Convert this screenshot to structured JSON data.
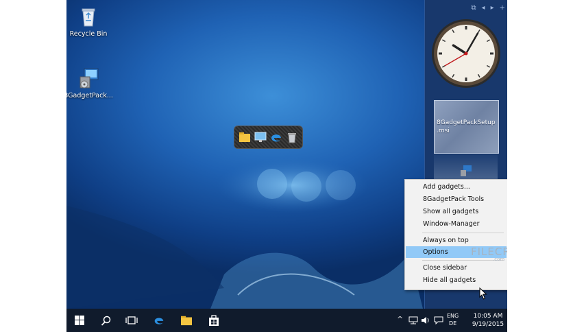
{
  "desktop": {
    "icons": [
      {
        "label": "Recycle Bin",
        "icon": "recycle-bin-icon"
      },
      {
        "label": "8GadgetPack...",
        "icon": "installer-icon"
      }
    ]
  },
  "launcher": {
    "items": [
      "file-explorer-icon",
      "desktop-icon",
      "edge-icon",
      "recycle-bin-icon"
    ]
  },
  "sidebar": {
    "toolbar_icons": [
      "restore-icon",
      "prev-icon",
      "next-icon",
      "add-icon"
    ],
    "toolbar_glyphs": [
      "⧉",
      "◂",
      "▸",
      "+"
    ],
    "clock": {
      "hour": 10,
      "minute": 5,
      "second": 40
    },
    "file_gadget_label": "8GadgetPackSetup.msi"
  },
  "context_menu": {
    "items": [
      {
        "label": "Add gadgets..."
      },
      {
        "label": "8GadgetPack Tools"
      },
      {
        "label": "Show all gadgets"
      },
      {
        "label": "Window-Manager"
      },
      {
        "label": "Always on top"
      },
      {
        "label": "Options",
        "highlighted": true
      },
      {
        "label": "Close sidebar"
      },
      {
        "label": "Hide all gadgets"
      }
    ],
    "highlight_color": "#91c9f7"
  },
  "watermark": {
    "text": "FILECR",
    "sub": ".com"
  },
  "taskbar": {
    "buttons": [
      "start-icon",
      "search-icon",
      "task-view-icon",
      "edge-icon",
      "file-explorer-icon",
      "store-icon"
    ],
    "tray": {
      "chevron": "^",
      "language_top": "ENG",
      "language_bottom": "DE",
      "time": "10:05 AM",
      "date": "9/19/2015"
    }
  },
  "colors": {
    "sidebar": "#18386c",
    "taskbar": "#101b2c",
    "accent": "#3d8fd8"
  }
}
